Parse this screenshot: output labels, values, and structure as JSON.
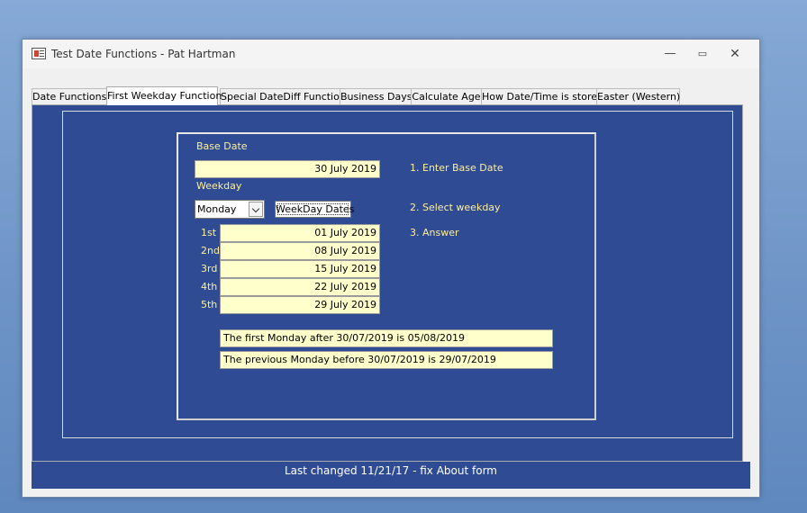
{
  "window": {
    "title": "Test Date Functions - Pat Hartman"
  },
  "window_buttons": {
    "minimize": "—",
    "maximize": "▭",
    "close": "✕"
  },
  "tabs": [
    {
      "label": "Date Functions"
    },
    {
      "label": "First Weekday Function"
    },
    {
      "label": "Special DateDiff Function"
    },
    {
      "label": "Business Days"
    },
    {
      "label": "Calculate Age"
    },
    {
      "label": "How Date/Time is stored"
    },
    {
      "label": "Easter (Western)"
    }
  ],
  "form": {
    "base_date_label": "Base Date",
    "base_date_value": "30 July 2019",
    "weekday_label": "Weekday",
    "weekday_value": "Monday",
    "weekday_button": "WeekDay Dates",
    "instructions": [
      "1. Enter Base Date",
      "2. Select weekday",
      "3. Answer"
    ],
    "results": [
      {
        "ordinal": "1st",
        "date": "01 July 2019"
      },
      {
        "ordinal": "2nd",
        "date": "08 July 2019"
      },
      {
        "ordinal": "3rd",
        "date": "15 July 2019"
      },
      {
        "ordinal": "4th",
        "date": "22 July 2019"
      },
      {
        "ordinal": "5th",
        "date": "29 July 2019"
      }
    ],
    "first_after": "The first Monday after 30/07/2019 is 05/08/2019",
    "previous_before": "The previous Monday before 30/07/2019 is 29/07/2019"
  },
  "footer": {
    "text": "Last changed 11/21/17 - fix About form"
  }
}
